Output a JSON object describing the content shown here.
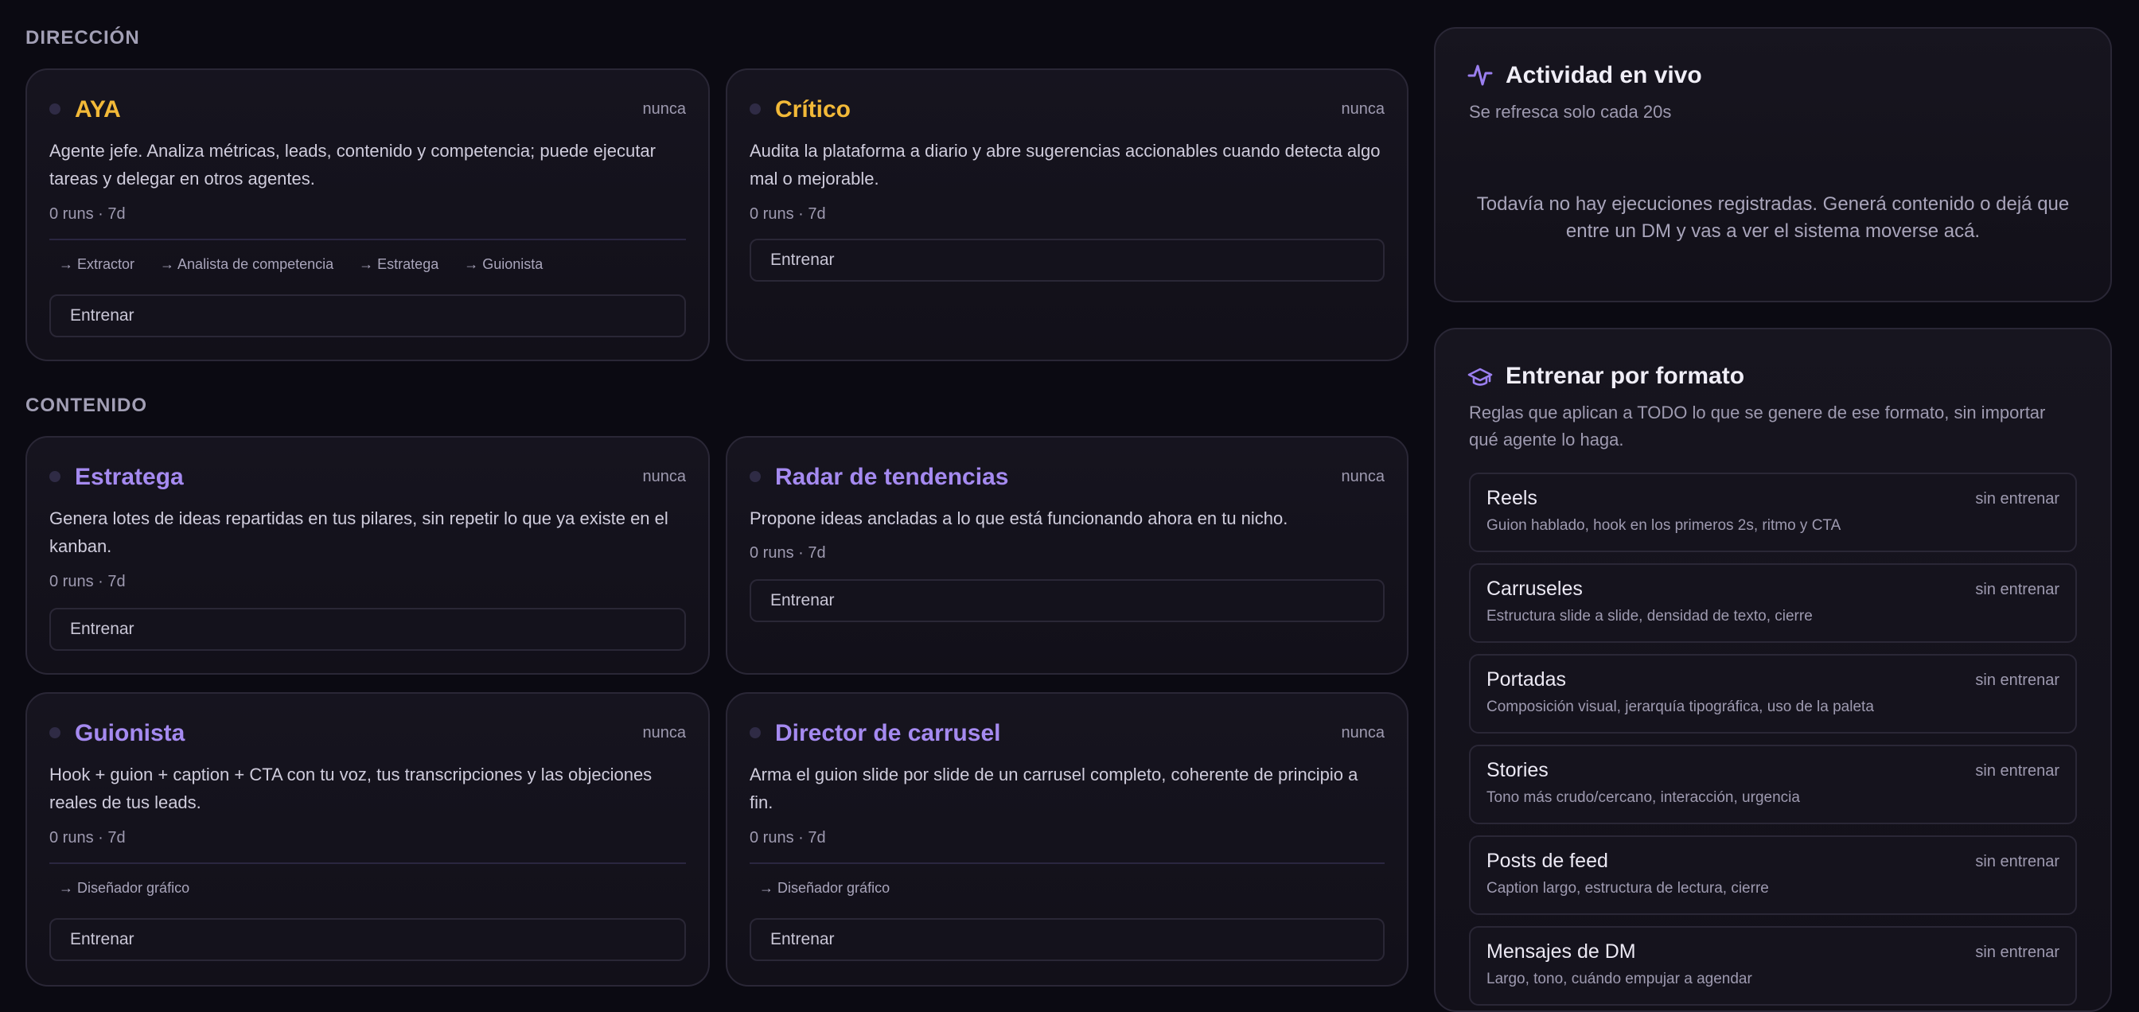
{
  "sections": {
    "direccion": "DIRECCIÓN",
    "contenido": "CONTENIDO"
  },
  "agents": {
    "aya": {
      "name": "AYA",
      "when": "nunca",
      "description": "Agente jefe. Analiza métricas, leads, contenido y competencia; puede ejecutar tareas y delegar en otros agentes.",
      "stats": "0 runs · 7d",
      "handoffs": [
        "→ Extractor",
        "→ Analista de competencia",
        "→ Estratega",
        "→ Guionista"
      ],
      "train_label": "Entrenar"
    },
    "critico": {
      "name": "Crítico",
      "when": "nunca",
      "description": "Audita la plataforma a diario y abre sugerencias accionables cuando detecta algo mal o mejorable.",
      "stats": "0 runs · 7d",
      "train_label": "Entrenar"
    },
    "estratega": {
      "name": "Estratega",
      "when": "nunca",
      "description": "Genera lotes de ideas repartidas en tus pilares, sin repetir lo que ya existe en el kanban.",
      "stats": "0 runs · 7d",
      "train_label": "Entrenar"
    },
    "radar": {
      "name": "Radar de tendencias",
      "when": "nunca",
      "description": "Propone ideas ancladas a lo que está funcionando ahora en tu nicho.",
      "stats": "0 runs · 7d",
      "train_label": "Entrenar"
    },
    "guionista": {
      "name": "Guionista",
      "when": "nunca",
      "description": "Hook + guion + caption + CTA con tu voz, tus transcripciones y las objeciones reales de tus leads.",
      "stats": "0 runs · 7d",
      "handoffs": [
        "→ Diseñador gráfico"
      ],
      "train_label": "Entrenar"
    },
    "director": {
      "name": "Director de carrusel",
      "when": "nunca",
      "description": "Arma el guion slide por slide de un carrusel completo, coherente de principio a fin.",
      "stats": "0 runs · 7d",
      "handoffs": [
        "→ Diseñador gráfico"
      ],
      "train_label": "Entrenar"
    }
  },
  "activity": {
    "title": "Actividad en vivo",
    "subtitle": "Se refresca solo cada 20s",
    "empty_message": "Todavía no hay ejecuciones registradas. Generá contenido o dejá que entre un DM y vas a ver el sistema moverse acá."
  },
  "formats": {
    "title": "Entrenar por formato",
    "subtitle": "Reglas que aplican a TODO lo que se genere de ese formato, sin importar qué agente lo haga.",
    "items": [
      {
        "name": "Reels",
        "status": "sin entrenar",
        "description": "Guion hablado, hook en los primeros 2s, ritmo y CTA"
      },
      {
        "name": "Carruseles",
        "status": "sin entrenar",
        "description": "Estructura slide a slide, densidad de texto, cierre"
      },
      {
        "name": "Portadas",
        "status": "sin entrenar",
        "description": "Composición visual, jerarquía tipográfica, uso de la paleta"
      },
      {
        "name": "Stories",
        "status": "sin entrenar",
        "description": "Tono más crudo/cercano, interacción, urgencia"
      },
      {
        "name": "Posts de feed",
        "status": "sin entrenar",
        "description": "Caption largo, estructura de lectura, cierre"
      },
      {
        "name": "Mensajes de DM",
        "status": "sin entrenar",
        "description": "Largo, tono, cuándo empujar a agendar"
      }
    ]
  },
  "colors": {
    "accent_purple": "#a58af0",
    "accent_gold": "#f2b938",
    "background": "#0b0a12"
  }
}
